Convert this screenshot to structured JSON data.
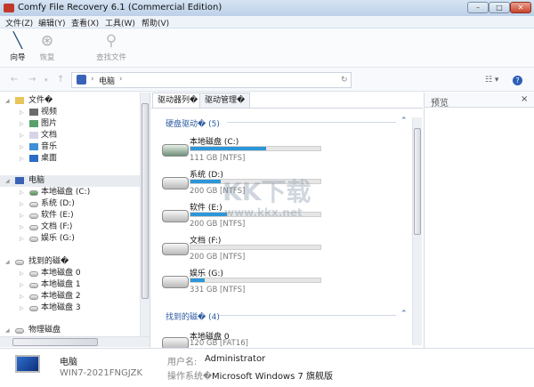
{
  "window": {
    "title": "Comfy File Recovery 6.1 (Commercial Edition)",
    "min": "–",
    "max": "□",
    "close": "✕"
  },
  "menu": [
    "文件(Z)",
    "编辑(Y)",
    "查看(X)",
    "工具(W)",
    "帮助(V)"
  ],
  "toolbar": {
    "wizard": "向导",
    "restore": "恢复",
    "find": "查找文件"
  },
  "address": {
    "path": "电脑",
    "sep": "›",
    "refresh": "↻",
    "help": "?",
    "view": "☷ ▾"
  },
  "tree": {
    "files": {
      "label": "文件�",
      "items": [
        "视频",
        "图片",
        "文档",
        "音乐",
        "桌面"
      ]
    },
    "computer": {
      "label": "电脑",
      "items": [
        "本地磁盘 (C:)",
        "系统 (D:)",
        "软件 (E:)",
        "文档 (F:)",
        "娱乐 (G:)"
      ]
    },
    "found": {
      "label": "找到的磁�",
      "items": [
        "本地磁盘 0",
        "本地磁盘 1",
        "本地磁盘 2",
        "本地磁盘 3"
      ]
    },
    "physical": {
      "label": "物理磁盘"
    }
  },
  "tabs": [
    "驱动器列�",
    "驱动管理�"
  ],
  "sections": {
    "hdd": {
      "label": "硬盘驱动� (5)",
      "drives": [
        {
          "name": "本地磁盘 (C:)",
          "size": "111 GB [NTFS]",
          "used": 0.58
        },
        {
          "name": "系统 (D:)",
          "size": "200 GB [NTFS]",
          "used": 0.23
        },
        {
          "name": "软件 (E:)",
          "size": "200 GB [NTFS]",
          "used": 0.28
        },
        {
          "name": "文档 (F:)",
          "size": "200 GB [NTFS]",
          "used": 0.0
        },
        {
          "name": "娱乐 (G:)",
          "size": "331 GB [NTFS]",
          "used": 0.11
        }
      ]
    },
    "found": {
      "label": "找到的磁� (4)",
      "drives": [
        {
          "name": "本地磁盘 0",
          "size": "120 GB [FAT16]"
        }
      ]
    }
  },
  "preview": {
    "title": "预览",
    "close": "×"
  },
  "info": {
    "name": "电脑",
    "host": "WIN7-2021FNGJZK",
    "user_label": "用户名:",
    "user": "Administrator",
    "os_label": "操作系统�",
    "os": "Microsoft Windows 7 旗舰版"
  },
  "watermark": {
    "logo": "KK下载",
    "url": "www.kkx.net"
  },
  "colors": {
    "accent": "#2d96d8",
    "section": "#2c5aa0"
  }
}
